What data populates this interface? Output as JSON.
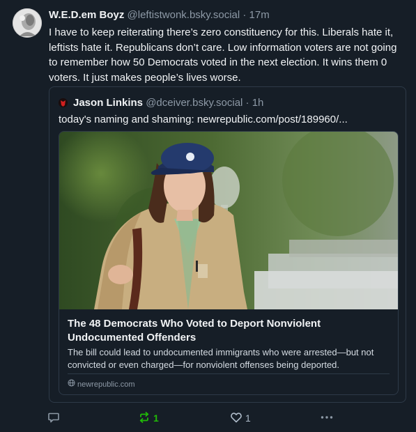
{
  "post": {
    "author_name": "W.E.D.em Boyz",
    "handle": "@leftistwonk.bsky.social",
    "separator": "·",
    "time": "17m",
    "text": "I have to keep reiterating there’s zero constituency for this. Liberals hate it, leftists hate it. Republicans don’t care. Low information voters are not going to remember how 50 Democrats voted in the next election. It wins them 0 voters. It just makes people’s lives worse."
  },
  "quote": {
    "author_name": "Jason Linkins",
    "handle": "@dceiver.bsky.social",
    "separator": "·",
    "time": "1h",
    "text": "today's naming and shaming: newrepublic.com/post/189960/...",
    "card": {
      "title": "The 48 Democrats Who Voted to Deport Nonviolent Undocumented Offenders",
      "description": "The bill could lead to undocumented immigrants who were arrested—but not convicted or even charged—for nonviolent offenses being deported.",
      "domain": "newrepublic.com",
      "domain_icon": "globe-icon",
      "image_alt": "woman-with-cap-photo"
    }
  },
  "actions": {
    "reply_count": "",
    "repost_count": "1",
    "like_count": "1",
    "reply_icon": "speech-bubble-icon",
    "repost_icon": "repost-arrows-icon",
    "like_icon": "heart-icon",
    "more_icon": "ellipsis-icon"
  },
  "colors": {
    "background": "#161e27",
    "text": "#f1f3f5",
    "muted": "#8d99a6",
    "border": "#2e3a48",
    "repost_active": "#20bc07"
  }
}
